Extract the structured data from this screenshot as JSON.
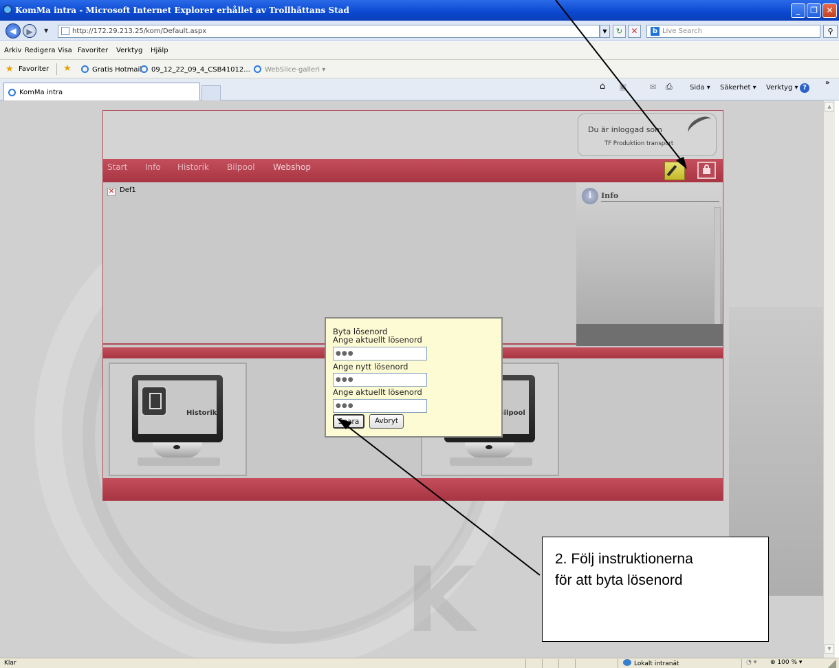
{
  "window": {
    "title": "KomMa intra - Microsoft Internet Explorer erhållet av Trollhättans Stad"
  },
  "address_bar": {
    "url": "http://172.29.213.25/kom/Default.aspx",
    "search_placeholder": "Live Search"
  },
  "menu": [
    "Arkiv",
    "Redigera",
    "Visa",
    "Favoriter",
    "Verktyg",
    "Hjälp"
  ],
  "favorites": {
    "label": "Favoriter",
    "links": [
      "Gratis Hotmail",
      "09_12_22_09_4_CSB41012...",
      "WebSlice-galleri ▾"
    ]
  },
  "tabs": [
    {
      "label": "KomMa intra"
    }
  ],
  "command_bar": {
    "page": "Sida ▾",
    "safety": "Säkerhet ▾",
    "tools": "Verktyg ▾",
    "more": "»"
  },
  "app": {
    "login": {
      "title": "Du är inloggad som",
      "user": "TF Produktion transport"
    },
    "nav": [
      "Start",
      "Info",
      "Historik",
      "Bilpool",
      "Webshop"
    ],
    "content": {
      "item": "Def1"
    },
    "info_panel": {
      "title": "Info"
    },
    "tiles": [
      {
        "label": "Historik"
      },
      {
        "label": "Bilpool"
      }
    ]
  },
  "dialog": {
    "title": "Byta lösenord",
    "current_label": "Ange aktuellt lösenord",
    "new_label": "Ange nytt lösenord",
    "confirm_label": "Ange aktuellt lösenord",
    "current_value": "●●●",
    "new_value": "●●●",
    "confirm_value": "●●●",
    "save_label": "Spara",
    "cancel_label": "Avbryt"
  },
  "callout": {
    "text": "2. Följ instruktionerna\nför att byta lösenord"
  },
  "statusbar": {
    "status": "Klar",
    "zone": "Lokalt intranät",
    "zoom": "100 %"
  },
  "colors": {
    "app_red": "#b04855",
    "dialog_bg": "#fdfbd4",
    "titlebar_blue": "#0b48d0"
  }
}
